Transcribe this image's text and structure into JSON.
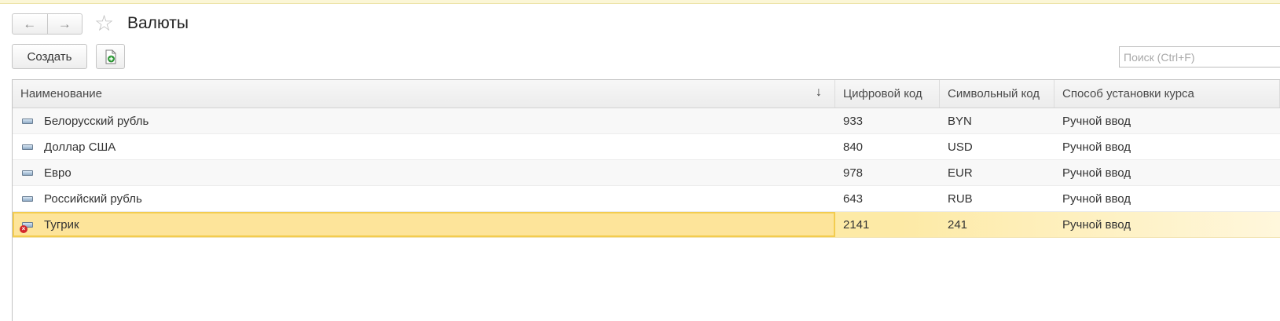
{
  "window": {
    "title": "Валюты"
  },
  "nav": {
    "back_glyph": "←",
    "forward_glyph": "→",
    "favorite_glyph": "☆"
  },
  "toolbar": {
    "create_label": "Создать",
    "copy_icon": "document-add-icon"
  },
  "search": {
    "placeholder": "Поиск (Ctrl+F)"
  },
  "table": {
    "sort_glyph": "↓",
    "columns": [
      "Наименование",
      "Цифровой код",
      "Символьный код",
      "Способ установки курса"
    ],
    "rows": [
      {
        "name": "Белорусский рубль",
        "num_code": "933",
        "sym_code": "BYN",
        "rate_method": "Ручной ввод"
      },
      {
        "name": "Доллар США",
        "num_code": "840",
        "sym_code": "USD",
        "rate_method": "Ручной ввод"
      },
      {
        "name": "Евро",
        "num_code": "978",
        "sym_code": "EUR",
        "rate_method": "Ручной ввод"
      },
      {
        "name": "Российский рубль",
        "num_code": "643",
        "sym_code": "RUB",
        "rate_method": "Ручной ввод"
      },
      {
        "name": "Тугрик",
        "num_code": "2141",
        "sym_code": "241",
        "rate_method": "Ручной ввод",
        "selected": true,
        "marked_for_deletion": true
      }
    ]
  },
  "colors": {
    "selection": "#fde79f",
    "selection_border": "#f3cc4f",
    "deletion_mark": "#d4272b"
  }
}
